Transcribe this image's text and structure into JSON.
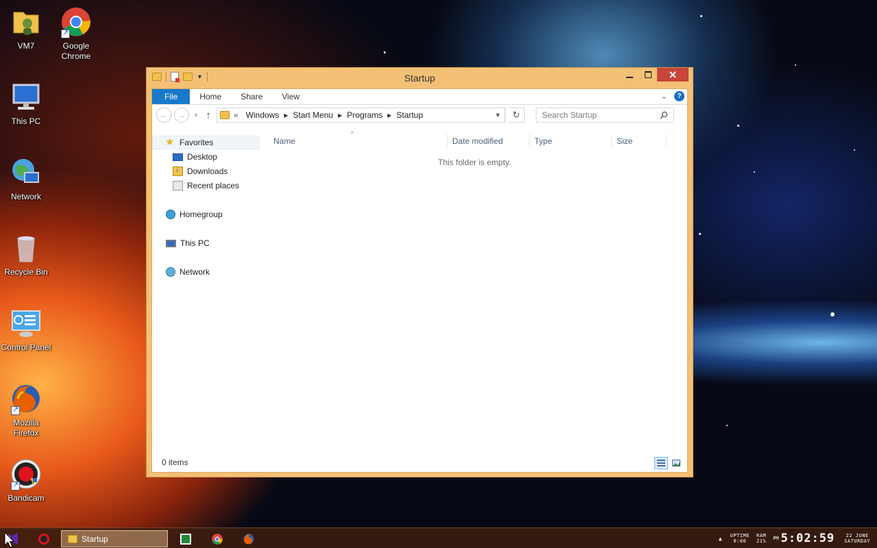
{
  "desktop": {
    "icons": [
      {
        "label": "VM7"
      },
      {
        "label": "Google Chrome"
      },
      {
        "label": "This PC"
      },
      {
        "label": "Network"
      },
      {
        "label": "Recycle Bin"
      },
      {
        "label": "Control Panel"
      },
      {
        "label": "Mozilla Firefox"
      },
      {
        "label": "Bandicam"
      }
    ]
  },
  "window": {
    "title": "Startup",
    "ribbon": {
      "file": "File",
      "home": "Home",
      "share": "Share",
      "view": "View"
    },
    "address": {
      "prefix": "«",
      "crumbs": [
        "Windows",
        "Start Menu",
        "Programs",
        "Startup"
      ]
    },
    "search": {
      "placeholder": "Search Startup"
    },
    "nav_pane": {
      "favorites": "Favorites",
      "desktop": "Desktop",
      "downloads": "Downloads",
      "recent": "Recent places",
      "homegroup": "Homegroup",
      "this_pc": "This PC",
      "network": "Network"
    },
    "columns": {
      "name": "Name",
      "date_modified": "Date modified",
      "type": "Type",
      "size": "Size"
    },
    "empty_message": "This folder is empty.",
    "status": "0 items"
  },
  "taskbar": {
    "active_window": "Startup",
    "tray": {
      "uptime_label": "UPTIME",
      "uptime_value": "0:00",
      "ram_label": "RAM",
      "ram_value": "21%",
      "ampm": "PM",
      "time": "5:02:59",
      "date": "22 JUNE",
      "day": "SATURDAY"
    }
  },
  "colors": {
    "ribbon_file_tab": "#1979ca",
    "window_frame": "#f4c075",
    "close_button": "#c7453a"
  }
}
